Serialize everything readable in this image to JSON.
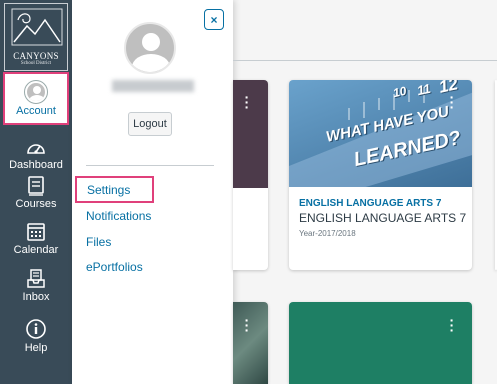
{
  "global_nav": {
    "logo": {
      "name": "CANYONS",
      "subtitle": "School District"
    },
    "items": [
      {
        "label": "Account",
        "icon": "account-avatar-icon",
        "active": true
      },
      {
        "label": "Dashboard",
        "icon": "dashboard-icon"
      },
      {
        "label": "Courses",
        "icon": "courses-icon"
      },
      {
        "label": "Calendar",
        "icon": "calendar-icon"
      },
      {
        "label": "Inbox",
        "icon": "inbox-icon"
      },
      {
        "label": "Help",
        "icon": "help-icon"
      }
    ],
    "colors": {
      "background": "#394B58",
      "highlight": "#E0407B",
      "link": "#0770A3"
    }
  },
  "account_tray": {
    "close_label": "×",
    "logout_label": "Logout",
    "links": [
      "Settings",
      "Notifications",
      "Files",
      "ePortfolios"
    ]
  },
  "dashboard": {
    "cards": [
      {
        "course_code": "ENGLISH LANGUAGE ARTS 7",
        "course_name": "ENGLISH LANGUAGE ARTS 7",
        "term": "Year-2017/2018",
        "image_text": [
          "WHAT HAVE YOU",
          "LEARNED?"
        ],
        "ruler_numbers": [
          "10",
          "11",
          "12"
        ]
      }
    ],
    "card_colors": [
      "#4c3a4a",
      "#3e6f98",
      "#3f5a56",
      "#1E7F64"
    ]
  }
}
